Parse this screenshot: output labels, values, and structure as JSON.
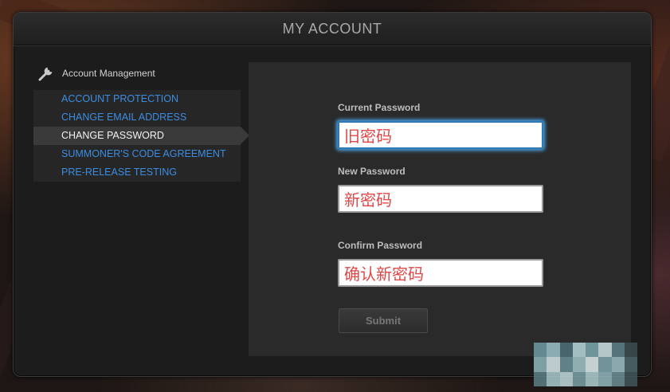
{
  "window": {
    "title": "MY ACCOUNT"
  },
  "sidebar": {
    "header": "Account Management",
    "items": [
      {
        "label": "ACCOUNT PROTECTION",
        "active": false
      },
      {
        "label": "CHANGE EMAIL ADDRESS",
        "active": false
      },
      {
        "label": "CHANGE PASSWORD",
        "active": true
      },
      {
        "label": "SUMMONER'S CODE AGREEMENT",
        "active": false
      },
      {
        "label": "PRE-RELEASE TESTING",
        "active": false
      }
    ]
  },
  "form": {
    "current_password": {
      "label": "Current Password",
      "value": "旧密码"
    },
    "new_password": {
      "label": "New Password",
      "value": "新密码"
    },
    "confirm_password": {
      "label": "Confirm Password",
      "value": "确认新密码"
    },
    "submit_label": "Submit"
  },
  "colors": {
    "link": "#3c8de0",
    "active_item": "#f2f2f2",
    "input_text": "#e04848",
    "focus_glow": "#4aa6e8"
  },
  "icons": {
    "sidebar_header": "wrench-icon"
  }
}
